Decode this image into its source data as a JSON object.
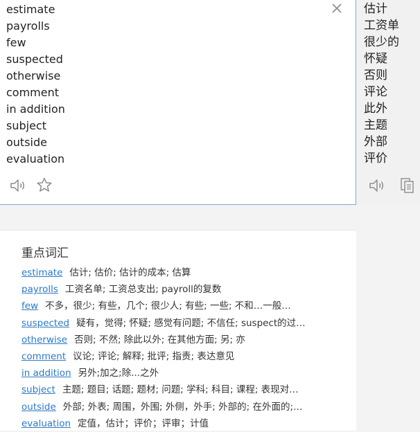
{
  "source": {
    "lines": [
      "estimate",
      "payrolls",
      "few",
      "suspected",
      "otherwise",
      "comment",
      "in addition",
      "subject",
      "outside",
      "evaluation"
    ]
  },
  "target": {
    "lines": [
      "估计",
      "工资单",
      "很少的",
      "怀疑",
      "否则",
      "评论",
      "此外",
      "主题",
      "外部",
      "评价"
    ]
  },
  "vocabulary": {
    "title": "重点词汇",
    "items": [
      {
        "word": "estimate",
        "definition": "估计; 估价; 估计的成本; 估算"
      },
      {
        "word": "payrolls",
        "definition": "工资名单; 工资总支出; payroll的复数"
      },
      {
        "word": "few",
        "definition": "不多，很少; 有些，几个; 很少人; 有些; 一些; 不和…一般…"
      },
      {
        "word": "suspected",
        "definition": "疑有，觉得; 怀疑; 感觉有问题; 不信任; suspect的过…"
      },
      {
        "word": "otherwise",
        "definition": "否则; 不然; 除此以外; 在其他方面; 另; 亦"
      },
      {
        "word": "comment",
        "definition": "议论; 评论; 解释; 批评; 指责; 表达意见"
      },
      {
        "word": "in addition",
        "definition": "另外;加之;除...之外"
      },
      {
        "word": "subject",
        "definition": "主题; 题目; 话题; 题材; 问题; 学科; 科目; 课程; 表现对…"
      },
      {
        "word": "outside",
        "definition": "外部; 外表; 周围，外围; 外侧，外手; 外部的; 在外面的;…"
      },
      {
        "word": "evaluation",
        "definition": "定值，估计；评价；评审；计值"
      }
    ]
  },
  "icons": {
    "clear": "close-icon",
    "speaker": "speaker-icon",
    "favorite": "star-icon",
    "copy": "copy-icon"
  },
  "colors": {
    "accent_link": "#2b79c6",
    "pane_border": "#7aa6d6",
    "target_bg": "#f1f1f1"
  }
}
